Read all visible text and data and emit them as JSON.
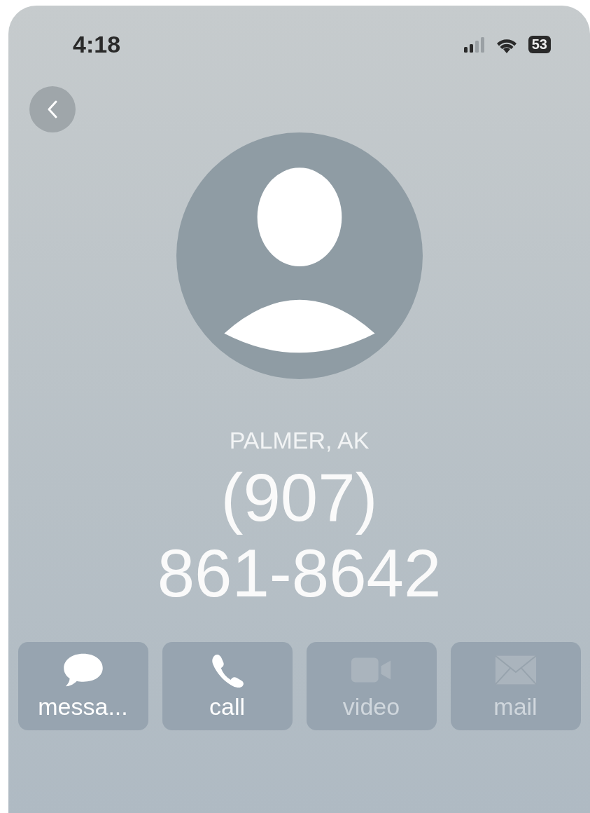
{
  "status_bar": {
    "time": "4:18",
    "battery": "53"
  },
  "contact": {
    "location": "PALMER, AK",
    "number_lines": [
      "(907)",
      "861-8642"
    ]
  },
  "actions": [
    {
      "kind": "message",
      "label": "messa...",
      "disabled": false
    },
    {
      "kind": "call",
      "label": "call",
      "disabled": false
    },
    {
      "kind": "video",
      "label": "video",
      "disabled": true
    },
    {
      "kind": "mail",
      "label": "mail",
      "disabled": true
    }
  ]
}
